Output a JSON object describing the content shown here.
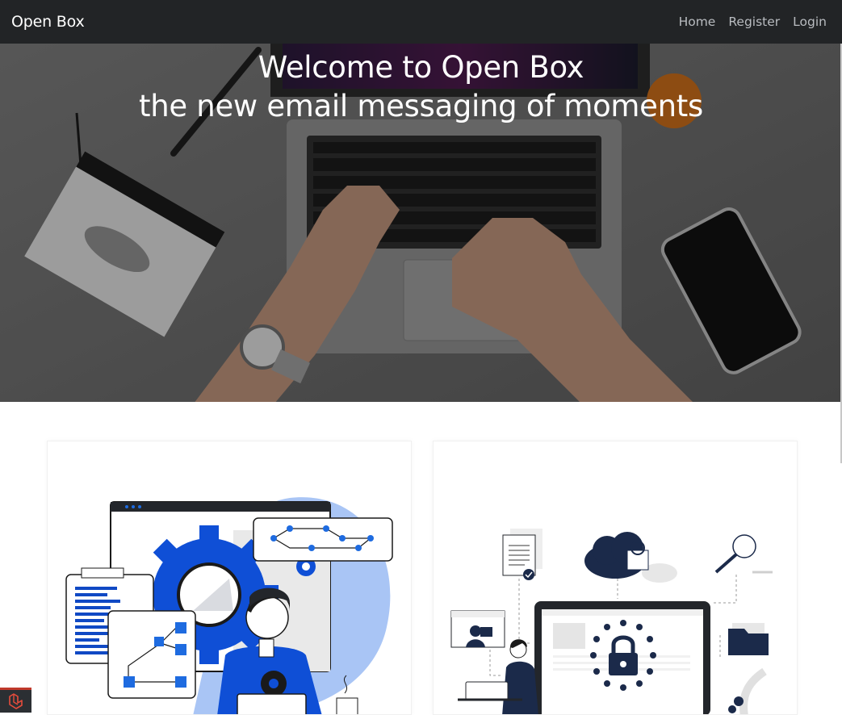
{
  "navbar": {
    "brand": "Open Box",
    "links": [
      {
        "label": "Home"
      },
      {
        "label": "Register"
      },
      {
        "label": "Login"
      }
    ]
  },
  "hero": {
    "title_line1": "Welcome to Open Box",
    "title_line2": "the new email messaging of moments"
  },
  "cards": [
    {
      "illustration": "workflow-developer-illustration"
    },
    {
      "illustration": "data-security-illustration"
    }
  ],
  "footer_badge": {
    "icon": "laravel-icon"
  },
  "colors": {
    "navbar_bg": "#222426",
    "accent_blue": "#0f4fd6",
    "navy": "#1b2a4a"
  }
}
